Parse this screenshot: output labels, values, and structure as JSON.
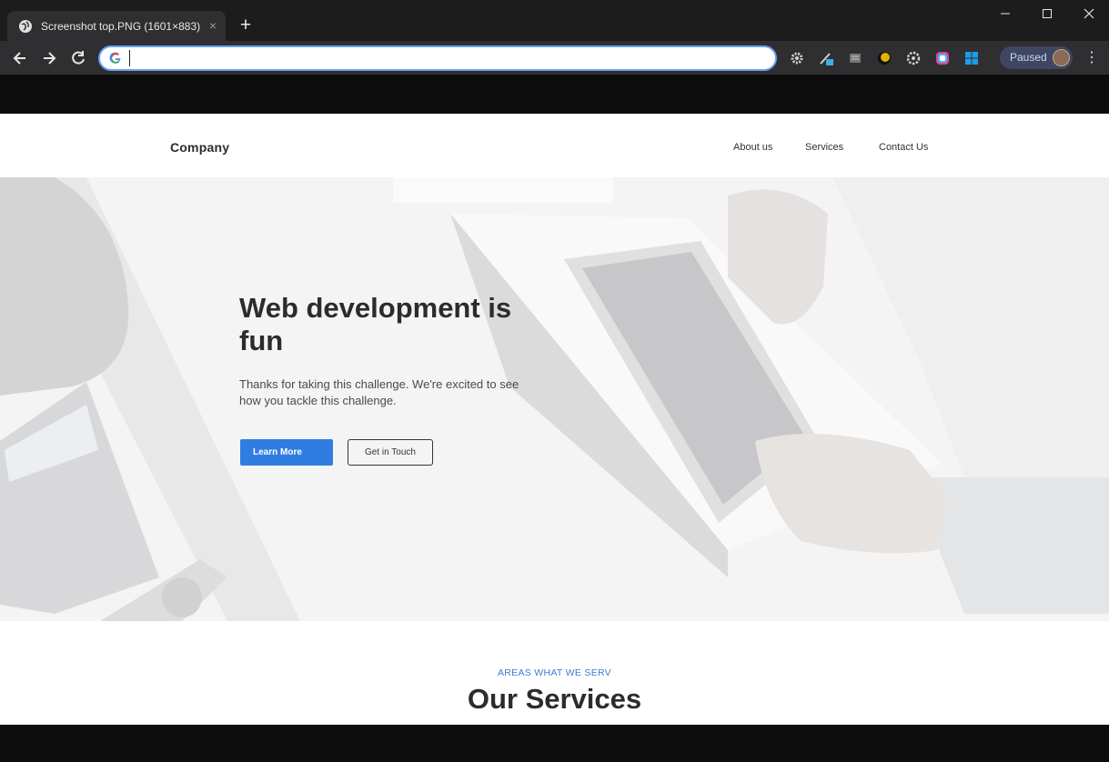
{
  "browser": {
    "tab_title": "Screenshot top.PNG (1601×883)",
    "tab_close": "×",
    "new_tab": "+",
    "omnibox_value": "",
    "profile_status": "Paused",
    "menu": "⋮"
  },
  "site": {
    "brand": "Company",
    "nav": [
      "About us",
      "Services",
      "Contact Us"
    ],
    "hero": {
      "title": "Web development is fun",
      "subtitle": "Thanks for taking this challenge. We're excited to see how you tackle this challenge.",
      "primary_button": "Learn More",
      "secondary_button": "Get in Touch"
    },
    "services": {
      "eyebrow": "AREAS WHAT WE SERV",
      "title": "Our Services"
    }
  },
  "colors": {
    "accent": "#2f7de1",
    "eyebrow": "#3b7bd4",
    "chrome_dark": "#1c1c1c",
    "chrome_toolbar": "#2f2f31"
  },
  "icons": [
    "globe-icon",
    "close-icon",
    "back-icon",
    "forward-icon",
    "reload-icon",
    "google-icon",
    "extension-icons",
    "avatar",
    "menu-icon"
  ]
}
